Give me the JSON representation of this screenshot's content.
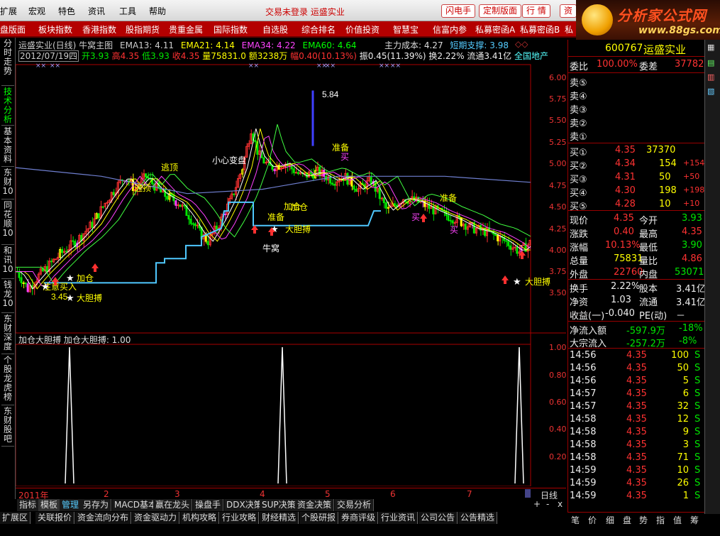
{
  "menu": {
    "items": [
      "扩展",
      "宏观",
      "特色",
      "资讯",
      "工具",
      "帮助"
    ],
    "status": "交易未登录  运盛实业",
    "buttons": [
      "闪电手",
      "定制版面",
      "行  情",
      "资"
    ]
  },
  "logo": {
    "title": "分析家公式网",
    "url": "www.88gs.com"
  },
  "nav": [
    "盘版面",
    "板块指数",
    "香港指数",
    "股指期货",
    "贵重金属",
    "国际指数",
    "自选股",
    "综合排名",
    "价值投资",
    "智慧宝",
    "信富内参",
    "私募密函A",
    "私募密函B",
    "私"
  ],
  "sidetabs": [
    "分时走势",
    "技术分析",
    "基本资料",
    "东财10",
    "同花顺10",
    "和讯10",
    "钱龙10",
    "东财深度",
    "个股龙虎榜",
    "东财股吧"
  ],
  "chart": {
    "title_line": "运盛实业(日线) 牛窝主图",
    "ema": [
      {
        "label": "EMA13: 4.11",
        "color": "#ffffff"
      },
      {
        "label": "EMA21: 4.14",
        "color": "#ffff00"
      },
      {
        "label": "EMA34: 4.22",
        "color": "#ff40ff"
      },
      {
        "label": "EMA60: 4.64",
        "color": "#00ff00"
      }
    ],
    "cost_label": "主力成本: 4.27",
    "support_label": "短期支撑: 3.98",
    "info_date": "2012/07/19四",
    "info_open": "开3.93",
    "info_high": "高4.35",
    "info_low": "低3.93",
    "info_close": "收4.35",
    "info_vol": "量75831.0",
    "info_amt": "额3238万",
    "info_chg": "幅0.40(10.13%)",
    "info_amp": "振0.45(11.39%)",
    "info_turn": "换2.22%",
    "info_float": "流通3.41亿",
    "info_sector": "全国地产",
    "y_labels": [
      "6.00",
      "5.75",
      "5.50",
      "5.25",
      "5.00",
      "4.75",
      "4.50",
      "4.25",
      "4.00",
      "3.75",
      "3.50"
    ],
    "annotations": [
      "5.84",
      "准备",
      "逃顶",
      "逃顶",
      "小心变盘",
      "加仓",
      "大胆搏",
      "牛窝",
      "准备",
      "注意买入",
      "加仓",
      "3.45",
      "大胆搏",
      "买",
      "买",
      "准备",
      "加仓",
      "买",
      "大胆搏"
    ],
    "sub_title": "加仓大胆搏 加仓大胆搏: 1.00",
    "sub_y_labels": [
      "1.00",
      "0.80",
      "0.60",
      "0.40",
      "0.20"
    ],
    "x_labels": [
      "2011年",
      "2",
      "3",
      "4",
      "5",
      "6",
      "7"
    ],
    "period": "日线"
  },
  "quote": {
    "code": "600767",
    "name": "运盛实业",
    "weibi_label": "委比",
    "weibi": "100.00%",
    "weicha_label": "委差",
    "weicha": "37782",
    "sells": [
      {
        "label": "卖⑤",
        "price": "",
        "vol": ""
      },
      {
        "label": "卖④",
        "price": "",
        "vol": ""
      },
      {
        "label": "卖③",
        "price": "",
        "vol": ""
      },
      {
        "label": "卖②",
        "price": "",
        "vol": ""
      },
      {
        "label": "卖①",
        "price": "",
        "vol": ""
      }
    ],
    "buys": [
      {
        "label": "买①",
        "price": "4.35",
        "vol": "37370",
        "chg": ""
      },
      {
        "label": "买②",
        "price": "4.34",
        "vol": "154",
        "chg": "+154"
      },
      {
        "label": "买③",
        "price": "4.31",
        "vol": "50",
        "chg": "+50"
      },
      {
        "label": "买④",
        "price": "4.30",
        "vol": "198",
        "chg": "+198"
      },
      {
        "label": "买⑤",
        "price": "4.28",
        "vol": "10",
        "chg": "+10"
      }
    ],
    "stats": [
      {
        "l1": "现价",
        "v1": "4.35",
        "c1": "red",
        "l2": "今开",
        "v2": "3.93",
        "c2": "green"
      },
      {
        "l1": "涨跌",
        "v1": "0.40",
        "c1": "red",
        "l2": "最高",
        "v2": "4.35",
        "c2": "red"
      },
      {
        "l1": "涨幅",
        "v1": "10.13%",
        "c1": "red",
        "l2": "最低",
        "v2": "3.90",
        "c2": "green"
      },
      {
        "l1": "总量",
        "v1": "75831",
        "c1": "yel",
        "l2": "量比",
        "v2": "4.86",
        "c2": "red"
      },
      {
        "l1": "外盘",
        "v1": "22760",
        "c1": "red",
        "l2": "内盘",
        "v2": "53071",
        "c2": "green"
      }
    ],
    "stats2": [
      {
        "l1": "换手",
        "v1": "2.22%",
        "l2": "股本",
        "v2": "3.41亿"
      },
      {
        "l1": "净资",
        "v1": "1.03",
        "l2": "流通",
        "v2": "3.41亿"
      },
      {
        "l1": "收益(一)",
        "v1": "-0.040",
        "l2": "PE(动)",
        "v2": "－"
      }
    ],
    "flow": [
      {
        "label": "净流入额",
        "value": "-597.9万",
        "pct": "-18%"
      },
      {
        "label": "大宗流入",
        "value": "-257.2万",
        "pct": "-8%"
      }
    ],
    "ticks": [
      {
        "time": "14:56",
        "price": "4.35",
        "vol": "100",
        "side": "S"
      },
      {
        "time": "14:56",
        "price": "4.35",
        "vol": "50",
        "side": "S"
      },
      {
        "time": "14:56",
        "price": "4.35",
        "vol": "5",
        "side": "S"
      },
      {
        "time": "14:57",
        "price": "4.35",
        "vol": "6",
        "side": "S"
      },
      {
        "time": "14:57",
        "price": "4.35",
        "vol": "32",
        "side": "S"
      },
      {
        "time": "14:58",
        "price": "4.35",
        "vol": "12",
        "side": "S"
      },
      {
        "time": "14:58",
        "price": "4.35",
        "vol": "9",
        "side": "S"
      },
      {
        "time": "14:58",
        "price": "4.35",
        "vol": "3",
        "side": "S"
      },
      {
        "time": "14:58",
        "price": "4.35",
        "vol": "71",
        "side": "S"
      },
      {
        "time": "14:59",
        "price": "4.35",
        "vol": "10",
        "side": "S"
      },
      {
        "time": "14:59",
        "price": "4.35",
        "vol": "26",
        "side": "S"
      },
      {
        "time": "14:59",
        "price": "4.35",
        "vol": "1",
        "side": "S"
      }
    ],
    "bottom_tabs": [
      "笔",
      "价",
      "细",
      "盘",
      "势",
      "指",
      "值",
      "筹"
    ]
  },
  "bottom": {
    "row1": [
      "指标",
      "模板",
      "管理",
      "另存为",
      "MACD基本",
      "赢在龙头",
      "操盘手",
      "DDX决策",
      "SUP决策",
      "资金决策",
      "交易分析"
    ],
    "row2": [
      "扩展区",
      "关联报价",
      "资金流向分布",
      "资金驱动力",
      "机构攻略",
      "行业攻略",
      "财经精选",
      "个股研报",
      "券商评级",
      "行业资讯",
      "公司公告",
      "公告精选"
    ]
  }
}
